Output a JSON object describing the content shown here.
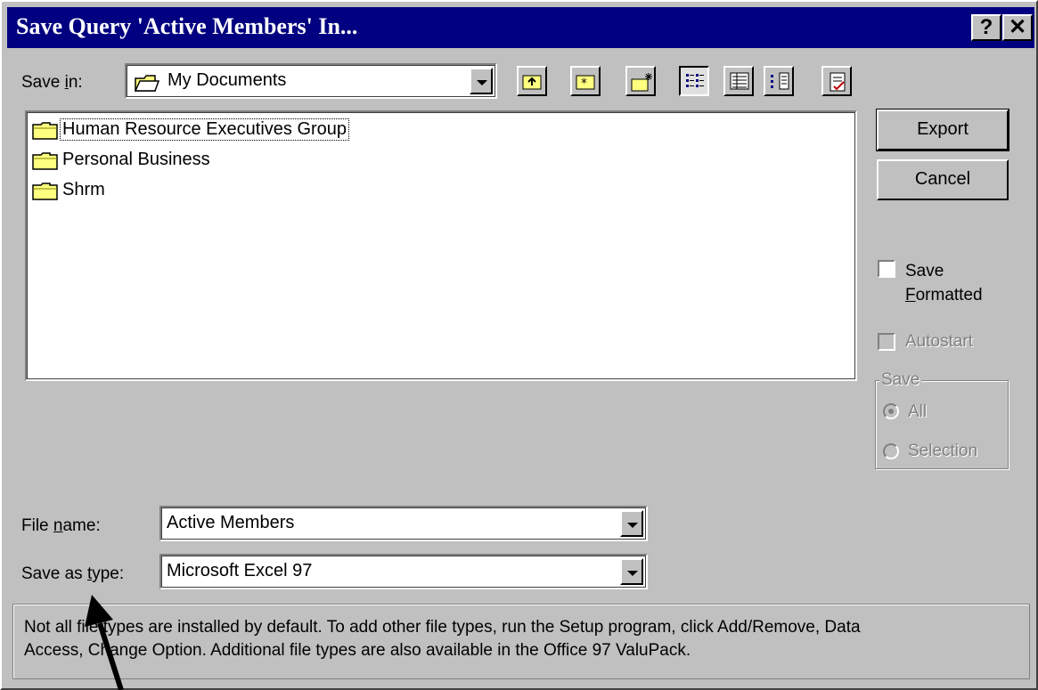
{
  "window": {
    "title": "Save Query 'Active Members' In...",
    "help_glyph": "?",
    "close_glyph": "✕"
  },
  "save_in": {
    "label_pre": "Save ",
    "label_accel": "i",
    "label_post": "n:",
    "value": "My Documents"
  },
  "toolbar": {
    "buttons": [
      "up-one-level",
      "look-in-favorites",
      "create-new-folder",
      "list",
      "details",
      "properties",
      "commands-and-settings"
    ]
  },
  "files": [
    {
      "name": "Human Resource Executives Group"
    },
    {
      "name": "Personal Business"
    },
    {
      "name": "Shrm"
    }
  ],
  "buttons": {
    "export": "Export",
    "cancel": "Cancel"
  },
  "options": {
    "save_formatted_line1": "Save",
    "save_formatted_accel": "F",
    "save_formatted_rest": "ormatted",
    "save_formatted_checked": false,
    "autostart": "Autostart",
    "autostart_enabled": false,
    "save_group": "Save",
    "all": "All",
    "selection": "Selection"
  },
  "file_name": {
    "label_pre": "File ",
    "label_accel": "n",
    "label_post": "ame:",
    "value": "Active Members"
  },
  "save_as_type": {
    "label_pre": "Save as ",
    "label_accel": "t",
    "label_post": "ype:",
    "value": "Microsoft Excel 97"
  },
  "note": {
    "line1": "Not all file types are installed by default.  To add other file types, run the Setup program, click Add/Remove, Data",
    "line2": "Access, Change Option.  Additional file types are also available in the Office 97 ValuPack."
  },
  "colors": {
    "title_bar": "#000080",
    "dialog_face": "#c0c0c0",
    "folder": "#ffff80"
  }
}
